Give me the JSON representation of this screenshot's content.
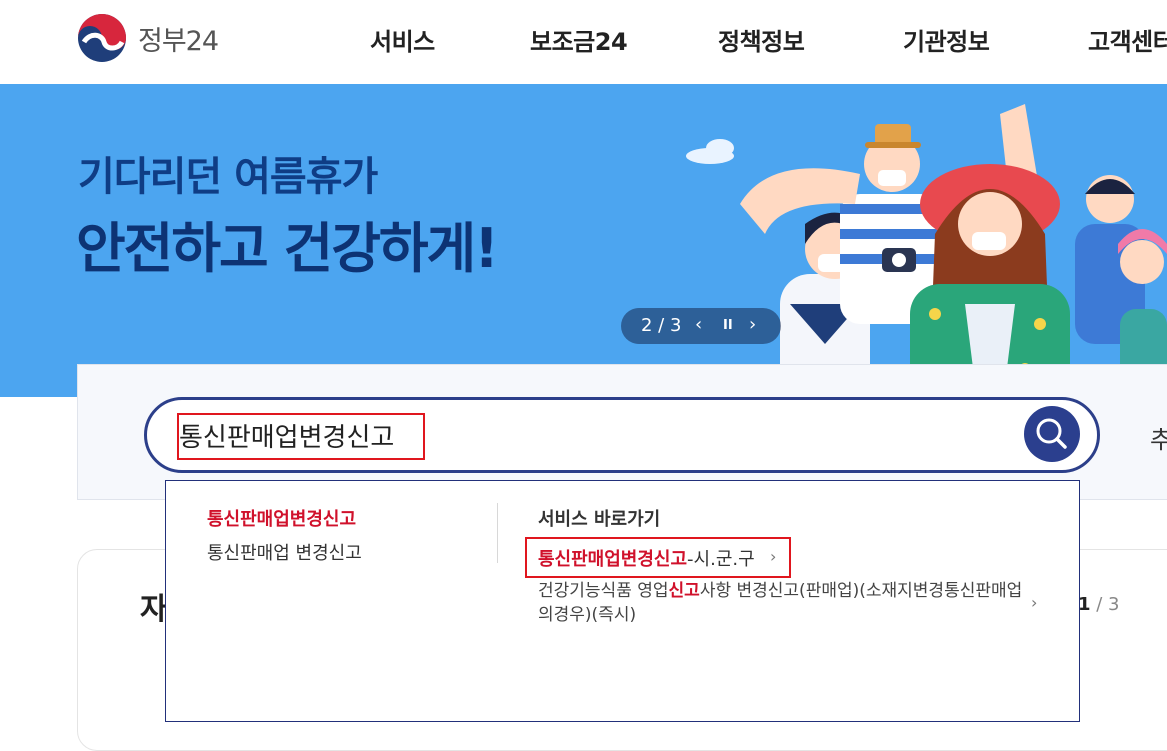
{
  "header": {
    "logo_text": "정부24",
    "nav": [
      "서비스",
      "보조금24",
      "정책정보",
      "기관정보",
      "고객센터"
    ]
  },
  "banner": {
    "line1": "기다리던 여름휴가",
    "line2": "안전하고 건강하게!",
    "pager": "2 / 3",
    "prev_icon": "‹",
    "pause_icon": "II",
    "next_icon": "›"
  },
  "search": {
    "value": "통신판매업변경신고",
    "side_text": "추"
  },
  "dropdown": {
    "suggest_bold": "통신판매업변경신고",
    "suggest_plain": "통신판매업 변경신고",
    "section_title": "서비스 바로가기",
    "service1_highlight": "통신판매업변경신고",
    "service1_rest": "-시.군.구",
    "service2_pre": "건강기능식품 영업",
    "service2_highlight": "신고",
    "service2_post": "사항 변경신고(판매업)(소재지변경통신판매업의경우)(즉시)",
    "chevron": "›"
  },
  "lower": {
    "title_partial": "자",
    "pager_current": "1",
    "pager_sep": " / ",
    "pager_total": "3"
  },
  "colors": {
    "brand_navy": "#2b3f8e",
    "banner_blue": "#4ca5f0",
    "highlight_red": "#d0112b"
  }
}
